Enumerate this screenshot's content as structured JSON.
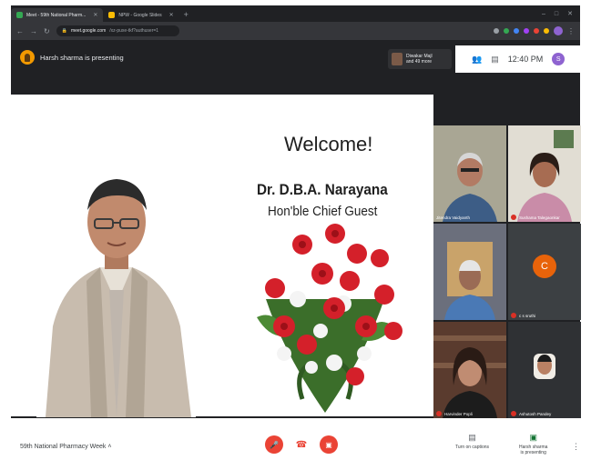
{
  "browser": {
    "tabs": [
      {
        "label": "Meet - 59th National Pharm...",
        "active": true,
        "color": "#34a853"
      },
      {
        "label": "NPW - Google Slides",
        "active": false,
        "color": "#fbbc04"
      }
    ],
    "new_tab": "+",
    "window_controls": [
      "–",
      "□",
      "✕"
    ],
    "url_host": "meet.google.com",
    "url_path": "/xz-puxe-tkf?authuser=1",
    "extension_colors": [
      "#9aa0a6",
      "#34a853",
      "#4285f4",
      "#a142f4",
      "#ea4335",
      "#fbbc04"
    ]
  },
  "meet": {
    "presenting_text": "Harsh sharma is presenting",
    "others_text": "Diwakar Majl\nand 49 more",
    "time": "12:40 PM",
    "user_initial": "S"
  },
  "slide": {
    "title": "Welcome!",
    "name": "Dr. D.B.A. Narayana",
    "role": "Hon'ble Chief Guest"
  },
  "participants": [
    {
      "name": "Jitendra Vaidyanth"
    },
    {
      "name": "Sushama Talegaonkar"
    },
    {
      "name": ""
    },
    {
      "name": "c s sruthi",
      "initial": "C"
    },
    {
      "name": "Harvinder Popli"
    },
    {
      "name": "Ashutosh Pandey"
    }
  ],
  "bottom": {
    "meeting_title": "59th National Pharmacy Week",
    "captions_label": "Turn on captions",
    "present_label": "Harsh sharma\nis presenting"
  },
  "colors": {
    "dark": "#202124",
    "red": "#ea4335",
    "accent": "#8e63d0",
    "tile_orange": "#e8630a"
  }
}
